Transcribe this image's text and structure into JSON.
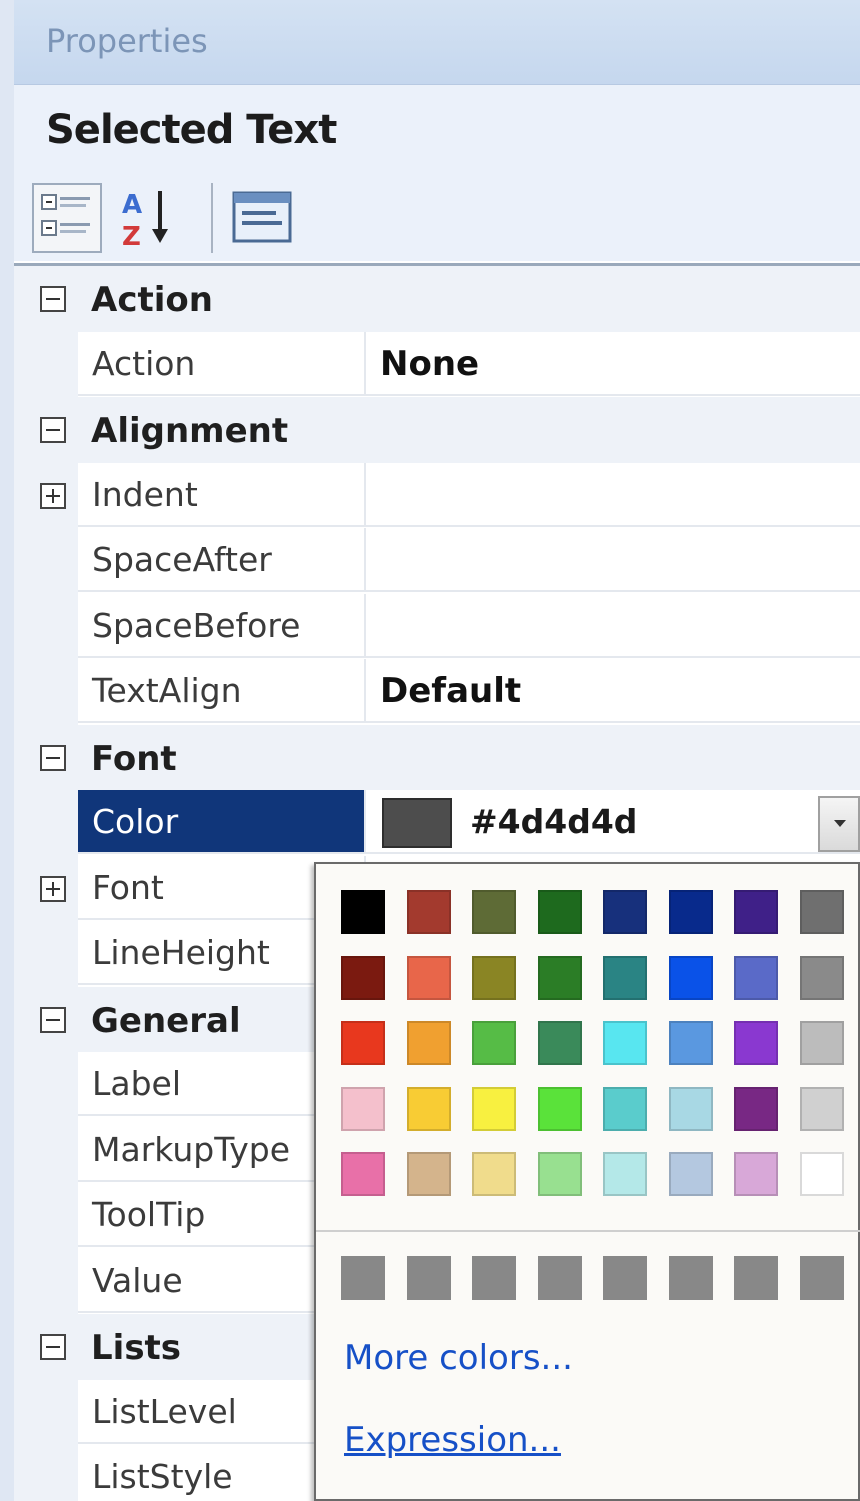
{
  "header": {
    "title": "Properties"
  },
  "selection": {
    "title": "Selected Text"
  },
  "toolbar": {
    "categorized_icon": "categorized-icon",
    "alphabetical_icon": "alphabetical-sort-icon",
    "property_pages_icon": "property-pages-icon"
  },
  "grid": {
    "rows": [
      {
        "kind": "category",
        "label": "Action",
        "expanded": true
      },
      {
        "kind": "property",
        "label": "Action",
        "value": "None"
      },
      {
        "kind": "category",
        "label": "Alignment",
        "expanded": true
      },
      {
        "kind": "property",
        "label": "Indent",
        "value": "",
        "expandable": true
      },
      {
        "kind": "property",
        "label": "SpaceAfter",
        "value": ""
      },
      {
        "kind": "property",
        "label": "SpaceBefore",
        "value": ""
      },
      {
        "kind": "property",
        "label": "TextAlign",
        "value": "Default"
      },
      {
        "kind": "category",
        "label": "Font",
        "expanded": true
      },
      {
        "kind": "property",
        "label": "Color",
        "value": "#4d4d4d",
        "selected": true
      },
      {
        "kind": "property",
        "label": "Font",
        "value": "",
        "expandable": true
      },
      {
        "kind": "property",
        "label": "LineHeight",
        "value": ""
      },
      {
        "kind": "category",
        "label": "General",
        "expanded": true
      },
      {
        "kind": "property",
        "label": "Label",
        "value": ""
      },
      {
        "kind": "property",
        "label": "MarkupType",
        "value": ""
      },
      {
        "kind": "property",
        "label": "ToolTip",
        "value": ""
      },
      {
        "kind": "property",
        "label": "Value",
        "value": ""
      },
      {
        "kind": "category",
        "label": "Lists",
        "expanded": true
      },
      {
        "kind": "property",
        "label": "ListLevel",
        "value": ""
      },
      {
        "kind": "property",
        "label": "ListStyle",
        "value": ""
      }
    ]
  },
  "color_picker": {
    "current": "#4d4d4d",
    "palette": [
      [
        "#000000",
        "#a33a2e",
        "#5e6b36",
        "#1e6a1e",
        "#17307c",
        "#082a8c",
        "#3f2088",
        "#6f6f6f"
      ],
      [
        "#7b1a10",
        "#e8664a",
        "#8a8524",
        "#2b7d26",
        "#2a8484",
        "#0a52e8",
        "#5a6ac8",
        "#8a8a8a"
      ],
      [
        "#e8381e",
        "#f0a030",
        "#56bc46",
        "#3a8a5a",
        "#58e6f0",
        "#5a98e0",
        "#8a38d0",
        "#bcbcbc"
      ],
      [
        "#f4c0cc",
        "#f8cc34",
        "#f8f040",
        "#5ae23a",
        "#5acccc",
        "#a8d8e4",
        "#782884",
        "#d0d0d0"
      ],
      [
        "#e870a8",
        "#d4b48c",
        "#f0dc8c",
        "#98e090",
        "#b4e8e8",
        "#b4c8e0",
        "#d8a8d8",
        "#ffffff"
      ]
    ],
    "recent": [
      "#888888",
      "#888888",
      "#888888",
      "#888888",
      "#888888",
      "#888888",
      "#888888",
      "#888888"
    ],
    "more_colors": "More colors...",
    "expression": "Expression..."
  }
}
